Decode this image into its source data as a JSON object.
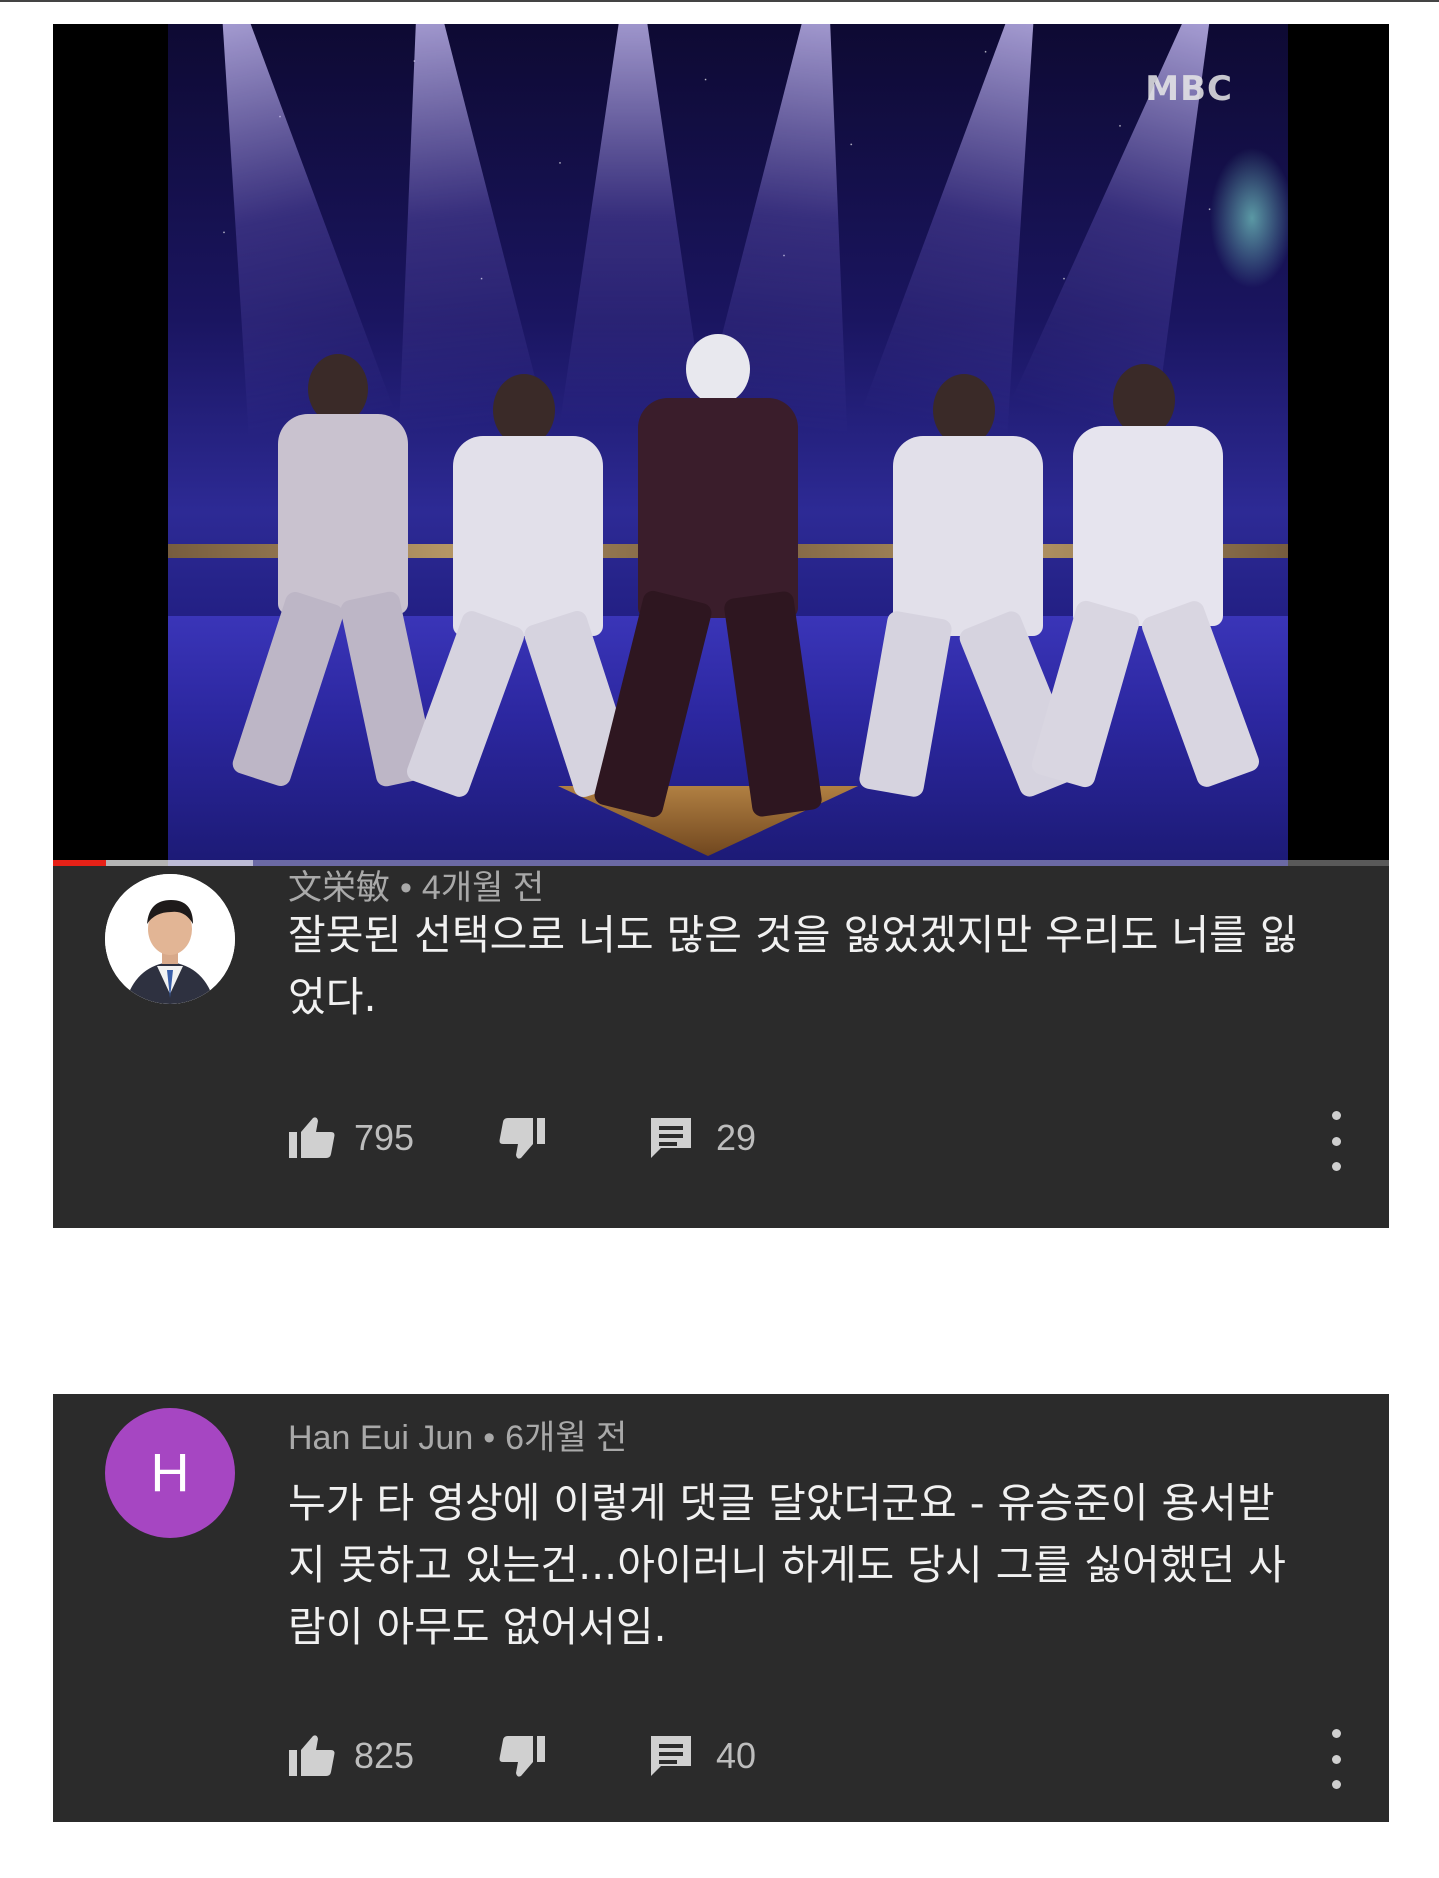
{
  "video": {
    "watermark": "MBC",
    "progress_played_fraction": 0.04,
    "progress_buffered_fraction": 0.15
  },
  "comments": [
    {
      "author": "文栄敏",
      "time": "4개월 전",
      "avatar": "profile-photo",
      "text": "잘못된 선택으로 너도 많은 것을 잃었겠지만 우리도 너를 잃었다.",
      "likes": "795",
      "replies": "29"
    },
    {
      "author": "Han Eui Jun",
      "time": "6개월 전",
      "avatar_letter": "H",
      "avatar_color": "#a646c2",
      "text": "누가 타 영상에 이렇게 댓글 달았더군요 - 유승준이 용서받지 못하고 있는건...아이러니 하게도 당시 그를 싫어했던 사람이 아무도 없어서임.",
      "likes": "825",
      "replies": "40"
    }
  ],
  "icons": {
    "like": "thumbs-up-icon",
    "dislike": "thumbs-down-icon",
    "reply": "reply-comment-icon",
    "more": "more-vertical-icon"
  },
  "colors": {
    "card_bg": "#2b2b2b",
    "progress_red": "#e62117",
    "text_primary": "#f1f1f1",
    "text_secondary": "#a9a9a9"
  }
}
